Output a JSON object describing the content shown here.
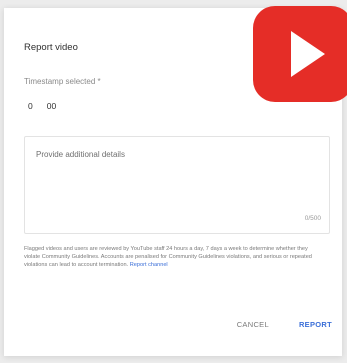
{
  "dialog": {
    "title": "Report video",
    "timestamp_label": "Timestamp selected *",
    "timestamp_minutes": "0",
    "timestamp_seconds": "00",
    "details_placeholder": "Provide additional details",
    "char_counter": "0/500",
    "disclaimer_text": "Flagged videos and users are reviewed by YouTube staff 24 hours a day, 7 days a week to determine whether they violate Community Guidelines. Accounts are penalised for Community Guidelines violations, and serious or repeated violations can lead to account termination.",
    "disclaimer_link": "Report channel",
    "cancel_label": "CANCEL",
    "report_label": "REPORT"
  },
  "logo": {
    "icon": "youtube-play-icon",
    "color": "#e52d27"
  },
  "colors": {
    "accent": "#3b6fd8",
    "muted_text": "#7a7a7a"
  }
}
